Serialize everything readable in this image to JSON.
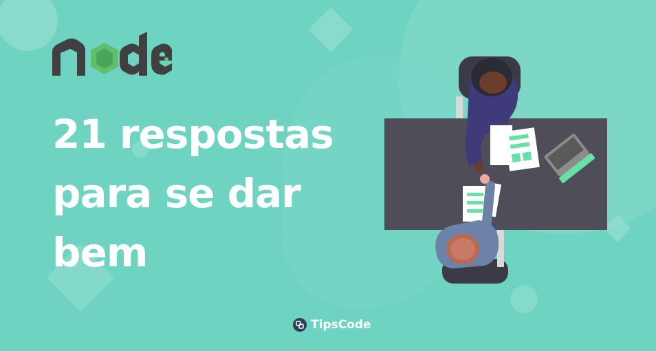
{
  "logo": {
    "text": "node",
    "icon": "nodejs-logo"
  },
  "headline": {
    "line1": "21 respostas",
    "line2": "para se dar",
    "line3": "bem"
  },
  "brand": {
    "name": "TipsCode",
    "icon": "tipscode-logo-icon"
  },
  "illustration": {
    "icon": "handshake-meeting-illustration"
  },
  "colors": {
    "background": "#6fd3c1",
    "text": "#ffffff",
    "node_dark": "#404040",
    "node_green": "#5fbf6b",
    "desk": "#4f4d57"
  }
}
